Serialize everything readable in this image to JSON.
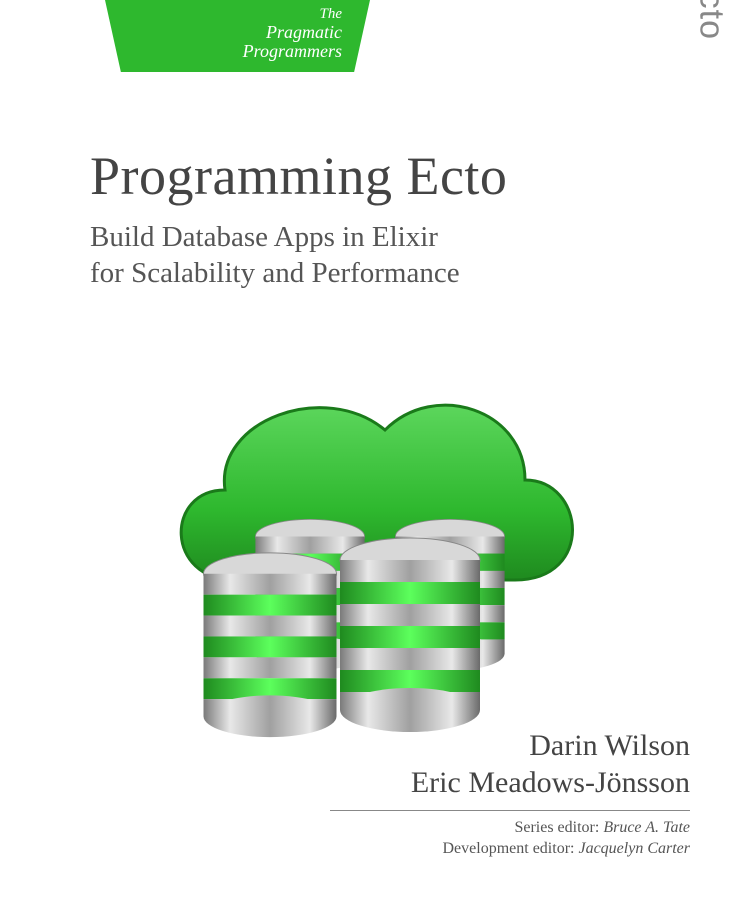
{
  "publisher": {
    "line1": "The",
    "line2": "Pragmatic",
    "line3": "Programmers"
  },
  "tech_badge": "ecto",
  "title": "Programming Ecto",
  "subtitle_line1": "Build Database Apps in Elixir",
  "subtitle_line2": "for Scalability and Performance",
  "authors": [
    "Darin Wilson",
    "Eric Meadows-Jönsson"
  ],
  "editors": [
    {
      "role": "Series editor:",
      "name": "Bruce A. Tate"
    },
    {
      "role": "Development editor:",
      "name": "Jacquelyn Carter"
    }
  ]
}
